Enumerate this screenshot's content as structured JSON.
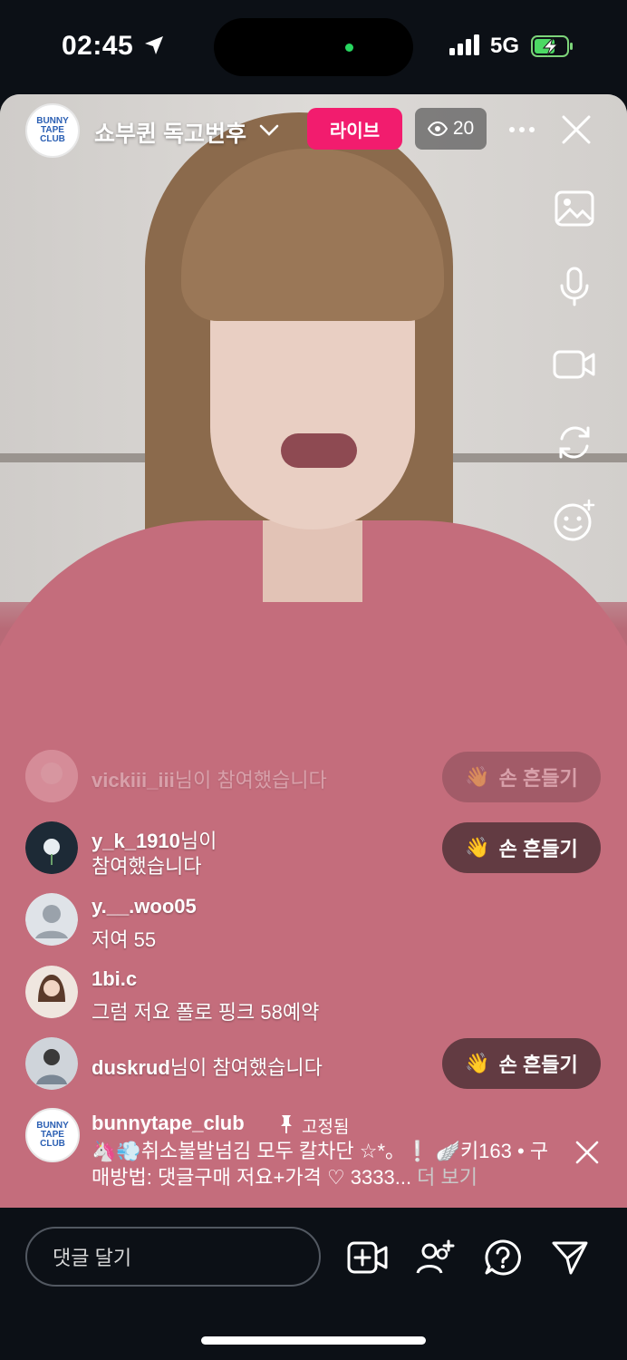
{
  "status_bar": {
    "time": "02:45",
    "network": "5G"
  },
  "header": {
    "host_name": "쇼부퀸 독고번후",
    "avatar_text": "BUNNY TAPE CLUB",
    "live_label": "라이브",
    "viewer_count": "20"
  },
  "side_tools": [
    "image-icon",
    "microphone-icon",
    "video-camera-icon",
    "flip-camera-icon",
    "face-effects-icon"
  ],
  "comments": [
    {
      "user": "vickiii_iii",
      "text": "님이 참여했습니다",
      "wave_label": "손 흔들기"
    },
    {
      "user": "y_k_1910",
      "text": "님이",
      "text2": "참여했습니다",
      "wave_label": "손 흔들기"
    },
    {
      "user": "y.__.woo05",
      "text": "저여 55"
    },
    {
      "user": "1bi.c",
      "text": "그럼 저요 폴로 핑크 58예약"
    },
    {
      "user": "duskrud",
      "text": "님이 참여했습니다",
      "wave_label": "손 흔들기"
    }
  ],
  "pinned": {
    "user": "bunnytape_club",
    "pinned_label": "고정됨",
    "line1": "🦄💨취소불발넘김 모두 칼차단 ☆*。❕ 🪽키163 • 구",
    "line2": "매방법: 댓글구매 저요+가격 ♡ 3333...",
    "more": " 더 보기"
  },
  "footer": {
    "comment_placeholder": "댓글 달기",
    "icons": [
      "add-video-icon",
      "add-guest-icon",
      "question-icon",
      "send-icon"
    ]
  }
}
